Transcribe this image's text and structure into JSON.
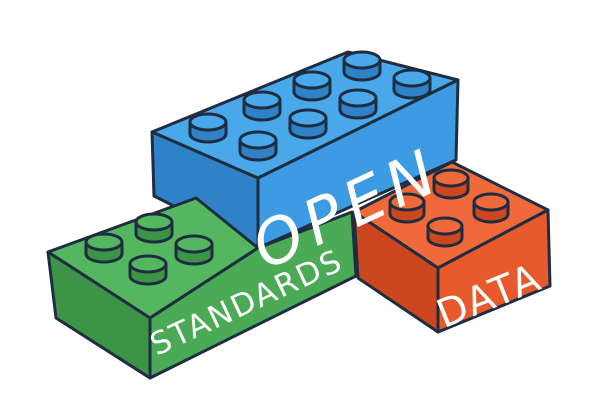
{
  "illustration": {
    "bricks": [
      {
        "id": "open",
        "label": "OPEN",
        "color": "#3d9be3",
        "shade": "#2f82c7"
      },
      {
        "id": "standards",
        "label": "STANDARDS",
        "color": "#4aaa55",
        "shade": "#3c9446"
      },
      {
        "id": "data",
        "label": "DATA",
        "color": "#e85a2c",
        "shade": "#cc4720"
      }
    ],
    "outline_color": "#1f2d40"
  }
}
